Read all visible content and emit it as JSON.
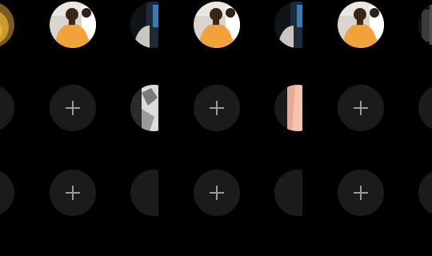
{
  "grid": {
    "background": "#000000",
    "circle_color": "#1b1b1b",
    "plus_color": "#9a9a9a",
    "icon": "plus-icon"
  }
}
